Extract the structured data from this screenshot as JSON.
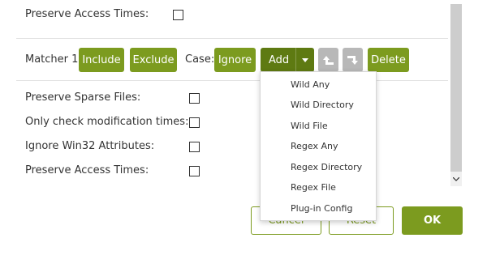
{
  "options_top": {
    "preserve_access_times_label": "Preserve Access Times:"
  },
  "matcher": {
    "label": "Matcher 1",
    "include_label": "Include",
    "exclude_label": "Exclude",
    "case_label": "Case:",
    "ignore_label": "Ignore",
    "add_label": "Add",
    "move_up_icon": "arrow-up-turn-icon",
    "move_down_icon": "arrow-down-turn-icon",
    "delete_label": "Delete"
  },
  "options": [
    {
      "label": "Preserve Sparse Files:",
      "checked": false
    },
    {
      "label": "Only check modification times:",
      "checked": false
    },
    {
      "label": "Ignore Win32 Attributes:",
      "checked": false
    },
    {
      "label": "Preserve Access Times:",
      "checked": false
    }
  ],
  "add_menu": {
    "items": [
      "Wild Any",
      "Wild Directory",
      "Wild File",
      "Regex Any",
      "Regex Directory",
      "Regex File",
      "Plug-in Config"
    ]
  },
  "footer": {
    "cancel_label": "Cancel",
    "reset_label": "Reset",
    "ok_label": "OK"
  },
  "colors": {
    "accent": "#7c9b1f",
    "accent_dark": "#5e7a12",
    "disabled": "#b8b8b8"
  }
}
